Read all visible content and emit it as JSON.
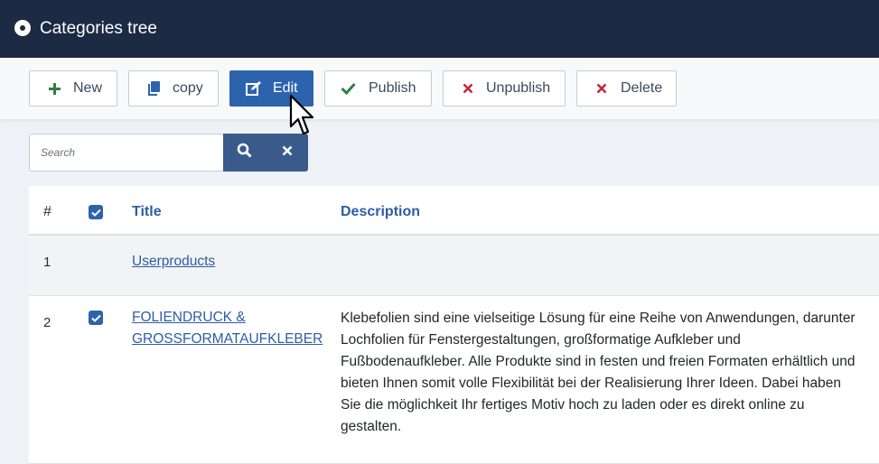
{
  "header": {
    "title": "Categories tree"
  },
  "toolbar": {
    "new_label": "New",
    "copy_label": "copy",
    "edit_label": "Edit",
    "publish_label": "Publish",
    "unpublish_label": "Unpublish",
    "delete_label": "Delete"
  },
  "search": {
    "placeholder": "Search"
  },
  "table": {
    "columns": {
      "number": "#",
      "title": "Title",
      "description": "Description"
    },
    "rows": [
      {
        "number": "1",
        "checked": false,
        "title": "Userproducts",
        "description": ""
      },
      {
        "number": "2",
        "checked": true,
        "title_line1": "FOLIENDRUCK &",
        "title_line2": "GROSSFORMATAUFKLEBER",
        "description": "Klebefolien sind eine vielseitige Lösung für eine Reihe von Anwendungen, darunter Lochfolien für Fenstergestaltungen, großformatige Aufkleber und Fußbodenaufkleber. Alle Produkte sind in festen und freien Formaten erhältlich und bieten Ihnen somit volle Flexibilität bei der Realisierung Ihrer Ideen. Dabei haben Sie die möglichkeit Ihr fertiges Motiv hoch zu laden oder es direkt online zu gestalten."
      }
    ]
  },
  "icons": {
    "plus": "plus-icon",
    "copy": "copy-icon",
    "edit": "edit-icon",
    "publish": "check-icon",
    "unpublish": "x-icon",
    "delete": "x-icon",
    "search": "search-icon",
    "clear": "close-icon"
  },
  "colors": {
    "topbar": "#1c2a43",
    "primary": "#2d63ad",
    "link": "#2d5da4",
    "green": "#2f7d43",
    "red": "#c8283a"
  }
}
